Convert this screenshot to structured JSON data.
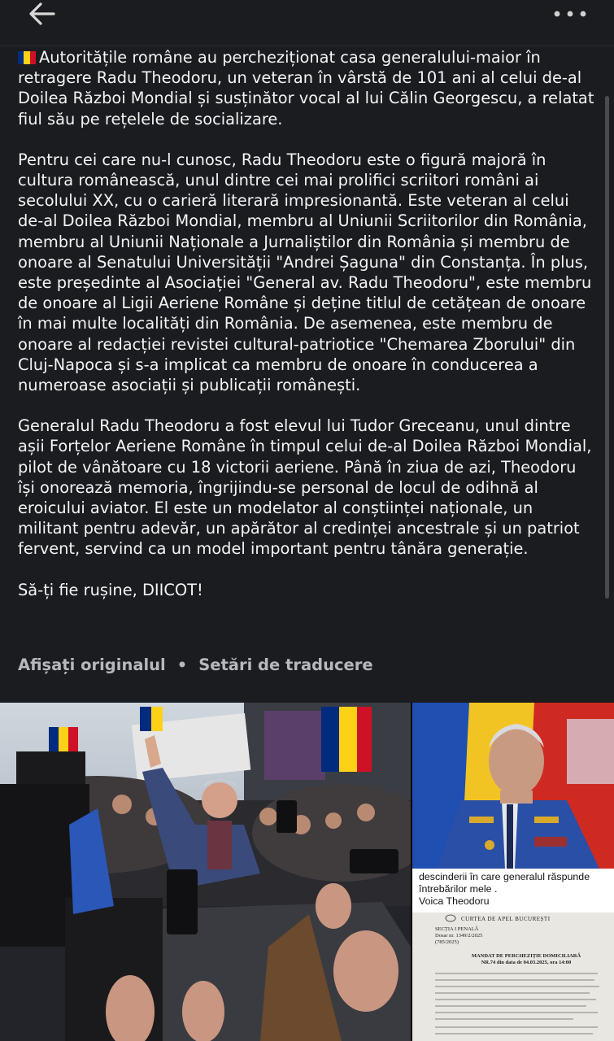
{
  "post": {
    "paragraphs": [
      "Autoritățile române au percheziționat casa generalului-maior în retragere Radu Theodoru, un veteran în vârstă de 101 ani al celui de-al Doilea Război Mondial și susținător vocal al lui Călin Georgescu, a relatat fiul său pe rețelele de socializare.",
      "Pentru cei care nu-l cunosc, Radu Theodoru este o figură majoră în cultura românească, unul dintre cei mai prolifici scriitori români ai secolului XX, cu o carieră literară impresionantă. Este veteran al celui de-al Doilea Război Mondial, membru al Uniunii Scriitorilor din România, membru al Uniunii Naționale a Jurnaliștilor din România și membru de onoare al Senatului Universității \"Andrei Șaguna\" din Constanța. În plus, este președinte al Asociației \"General av. Radu Theodoru\", este membru de onoare al Ligii Aeriene Române și deține titlul de cetățean de onoare în mai multe localități din România. De asemenea, este membru de onoare al redacției revistei cultural-patriotice \"Chemarea Zborului\" din Cluj-Napoca și s-a implicat ca membru de onoare în conducerea a numeroase asociații și publicații românești.",
      "Generalul Radu Theodoru a fost elevul lui Tudor Greceanu, unul dintre așii Forțelor Aeriene Române în timpul celui de-al Doilea Război Mondial, pilot de vânătoare cu 18 victorii aeriene. Până în ziua de azi, Theodoru își onorează memoria, îngrijindu-se personal de locul de odihnă al eroicului aviator. El este un modelator al conștiinței naționale, un militant pentru adevăr, un apărător al credinței ancestrale și un patriot fervent, servind ca un model important pentru tânăra generație.",
      "Să-ți fie rușine, DIICOT!"
    ]
  },
  "translation": {
    "show_original": "Afișați originalul",
    "separator": "•",
    "settings": "Setări de traducere"
  },
  "media": {
    "caption_lines": [
      "descinderii în care generalul răspunde",
      "întrebărilor mele .",
      "Voica Theodoru"
    ],
    "document": {
      "header": "CURTEA DE APEL BUCUREȘTI",
      "section": "SECȚIA I PENALĂ",
      "file_no": "Dosar nr. 1349/2/2025",
      "file_sub": "(785/2025)",
      "title_1": "MANDAT DE PERCHEZIȚIE DOMICILIARĂ",
      "title_2": "NR.74 din data de 04.03.2025, ora 14:00"
    }
  },
  "icons": {
    "back": "arrow-left-icon",
    "more": "more-dots-icon",
    "flag": "romania-flag-icon"
  },
  "colors": {
    "background": "#1b1c20",
    "text": "#f4f4f4",
    "muted": "#b6b8bd",
    "flag_blue": "#002b7f",
    "flag_yellow": "#fcd116",
    "flag_red": "#ce1126"
  }
}
